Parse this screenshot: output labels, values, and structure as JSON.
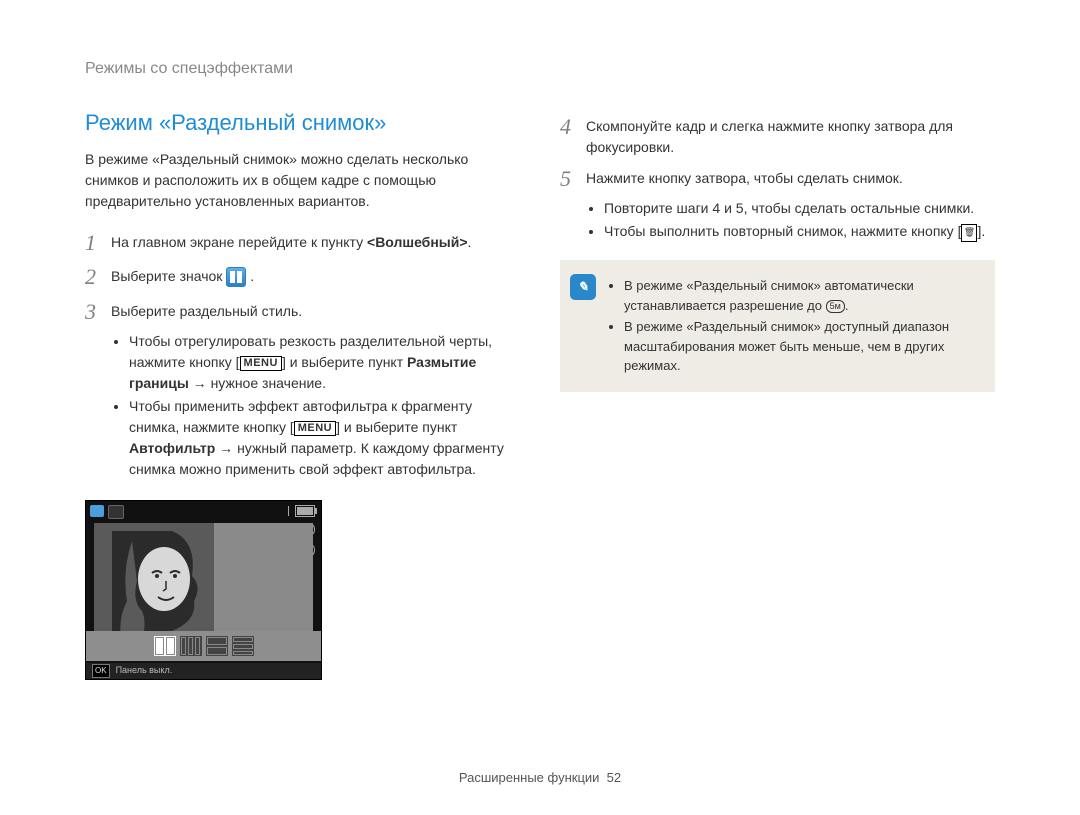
{
  "breadcrumb": "Режимы со спецэффектами",
  "title": "Режим «Раздельный снимок»",
  "intro": "В режиме «Раздельный снимок» можно сделать несколько снимков и расположить их в общем кадре с помощью предварительно установленных вариантов.",
  "steps": {
    "s1_pre": "На главном экране перейдите к пункту ",
    "s1_bold": "<Волшебный>",
    "s1_post": ".",
    "s2_pre": "Выберите значок ",
    "s2_post": ".",
    "s3": "Выберите раздельный стиль.",
    "s4": "Скомпонуйте кадр и слегка нажмите кнопку затвора для фокусировки.",
    "s5": "Нажмите кнопку затвора, чтобы сделать снимок."
  },
  "s3_bullets": {
    "b1_pre": "Чтобы отрегулировать резкость разделительной черты, нажмите кнопку [",
    "b1_menu": "MENU",
    "b1_mid": "] и выберите пункт ",
    "b1_bold": "Размытие границы",
    "b1_post": " → нужное значение.",
    "b2_pre": "Чтобы применить эффект автофильтра к фрагменту снимка, нажмите кнопку [",
    "b2_menu": "MENU",
    "b2_mid": "] и выберите пункт ",
    "b2_bold": "Автофильтр",
    "b2_post": " → нужный параметр. К каждому фрагменту снимка можно применить свой эффект автофильтра."
  },
  "s5_bullets": {
    "b1": "Повторите шаги 4 и 5, чтобы сделать остальные снимки.",
    "b2_pre": "Чтобы выполнить повторный снимок, нажмите кнопку [",
    "b2_post": "]."
  },
  "note": {
    "b1_pre": "В режиме «Раздельный снимок» автоматически устанавливается разрешение до ",
    "b1_res": "5м",
    "b1_post": ".",
    "b2": "В режиме «Раздельный снимок» доступный диапазон масштабирования может быть меньше, чем в других режимах."
  },
  "camera": {
    "footer_ok": "OK",
    "footer_label": "Панель выкл."
  },
  "footer": {
    "section": "Расширенные функции",
    "page": "52"
  }
}
